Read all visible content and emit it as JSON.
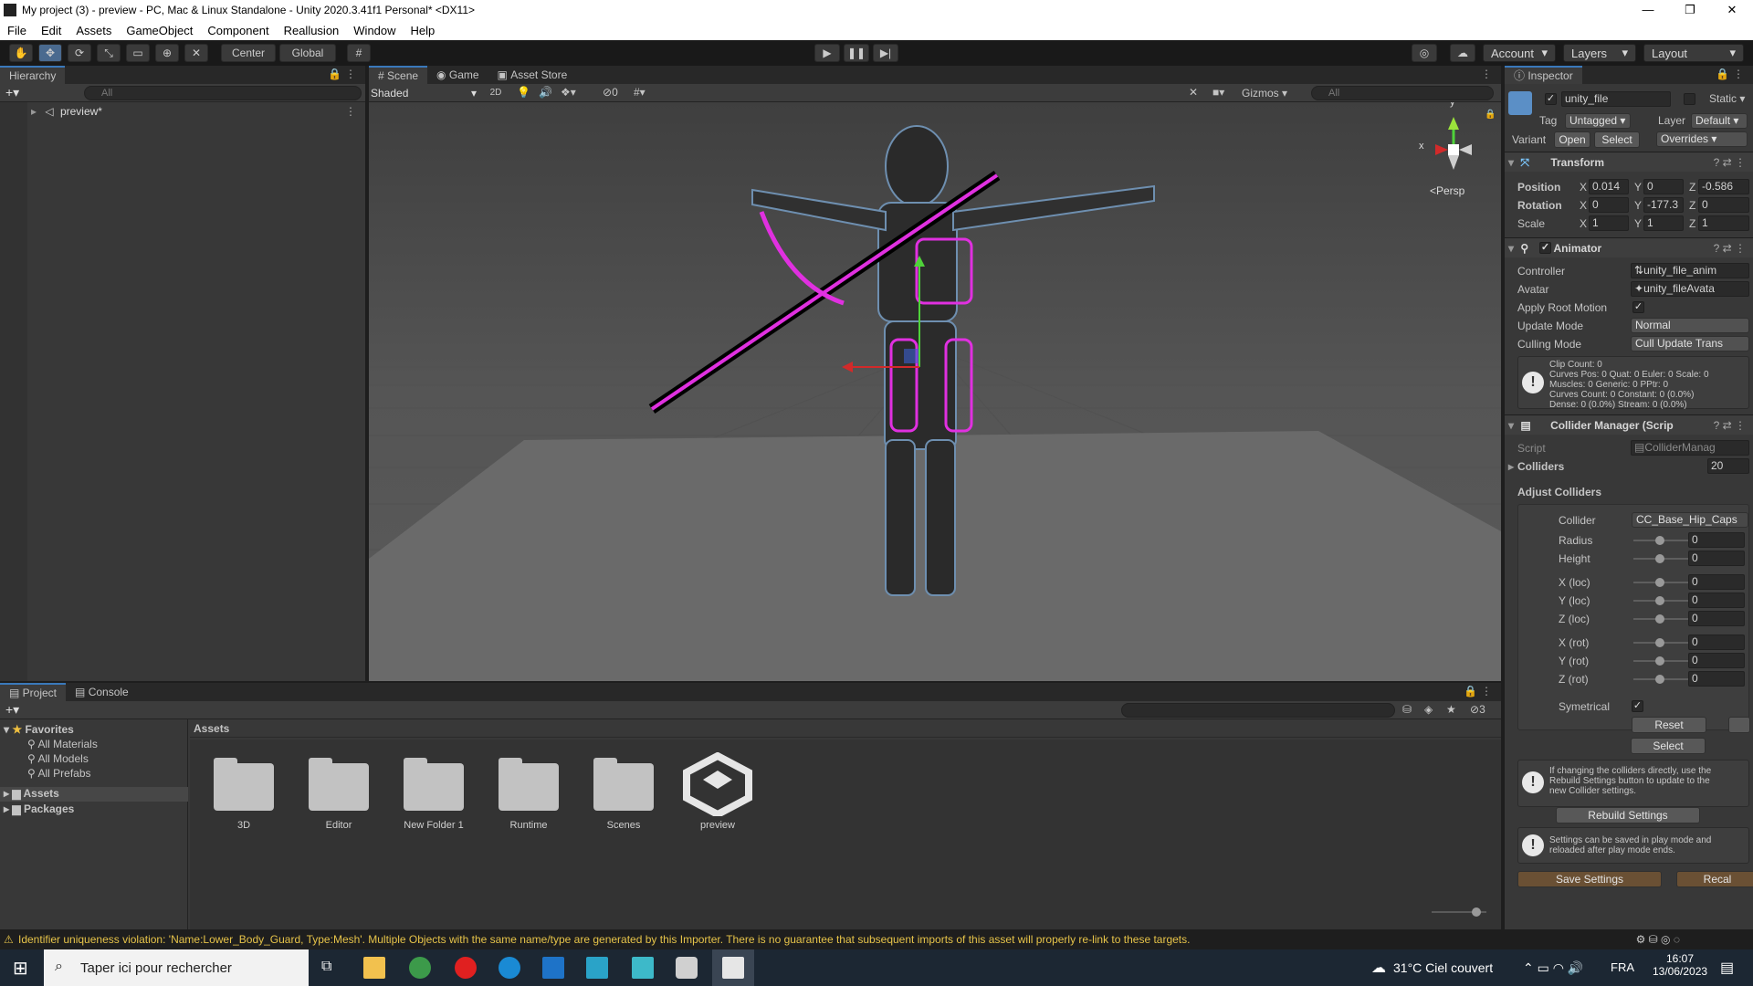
{
  "window": {
    "title": "My project (3) - preview - PC, Mac & Linux Standalone - Unity 2020.3.41f1 Personal* <DX11>"
  },
  "menu": [
    "File",
    "Edit",
    "Assets",
    "GameObject",
    "Component",
    "Reallusion",
    "Window",
    "Help"
  ],
  "toolbar": {
    "center_label": "Center",
    "global_label": "Global",
    "account_label": "Account",
    "layers_label": "Layers",
    "layout_label": "Layout"
  },
  "hierarchy": {
    "tab": "Hierarchy",
    "search_placeholder": "All",
    "root_item": "preview*"
  },
  "scene": {
    "tabs": [
      "Scene",
      "Game",
      "Asset Store"
    ],
    "shading_mode": "Shaded",
    "mode_2d": "2D",
    "hidden_count": "0",
    "gizmos_label": "Gizmos",
    "search_placeholder": "All",
    "persp_label": "<Persp",
    "axis_x": "x",
    "axis_y": "y"
  },
  "inspector": {
    "tab": "Inspector",
    "object_name": "unity_file",
    "static_label": "Static",
    "tag_label": "Tag",
    "tag_value": "Untagged",
    "layer_label": "Layer",
    "layer_value": "Default",
    "variant_label": "Variant",
    "open_label": "Open",
    "select_label": "Select",
    "overrides_label": "Overrides",
    "transform": {
      "title": "Transform",
      "position_label": "Position",
      "pos_x": "0.014",
      "pos_y": "0",
      "pos_z": "-0.586",
      "rotation_label": "Rotation",
      "rot_x": "0",
      "rot_y": "-177.3",
      "rot_z": "0",
      "scale_label": "Scale",
      "scale_x": "1",
      "scale_y": "1",
      "scale_z": "1",
      "x": "X",
      "y": "Y",
      "z": "Z"
    },
    "animator": {
      "title": "Animator",
      "controller_label": "Controller",
      "controller_value": "unity_file_anim",
      "avatar_label": "Avatar",
      "avatar_value": "unity_fileAvata",
      "apply_root_motion_label": "Apply Root Motion",
      "update_mode_label": "Update Mode",
      "update_mode_value": "Normal",
      "culling_mode_label": "Culling Mode",
      "culling_mode_value": "Cull Update Trans",
      "info_lines": [
        "Clip Count: 0",
        "Curves Pos: 0 Quat: 0 Euler: 0 Scale: 0",
        "Muscles: 0 Generic: 0 PPtr: 0",
        "Curves Count: 0 Constant: 0 (0.0%)",
        "Dense: 0 (0.0%) Stream: 0 (0.0%)"
      ]
    },
    "collider_manager": {
      "title": "Collider Manager (Scrip",
      "script_label": "Script",
      "script_value": "ColliderManag",
      "colliders_label": "Colliders",
      "colliders_value": "20",
      "adjust_label": "Adjust Colliders",
      "collider_label": "Collider",
      "collider_value": "CC_Base_Hip_Caps",
      "params": [
        {
          "label": "Radius",
          "value": "0"
        },
        {
          "label": "Height",
          "value": "0"
        },
        {
          "label": "X (loc)",
          "value": "0"
        },
        {
          "label": "Y (loc)",
          "value": "0"
        },
        {
          "label": "Z (loc)",
          "value": "0"
        },
        {
          "label": "X (rot)",
          "value": "0"
        },
        {
          "label": "Y (rot)",
          "value": "0"
        },
        {
          "label": "Z (rot)",
          "value": "0"
        }
      ],
      "symetrical_label": "Symetrical",
      "reset_label": "Reset",
      "select_label": "Select",
      "warning1": [
        "If changing the colliders directly, use the",
        "Rebuild Settings button to update to the",
        "new Collider settings."
      ],
      "rebuild_label": "Rebuild Settings",
      "warning2": [
        "Settings can be saved in play mode and",
        "reloaded after play mode ends."
      ],
      "save_label": "Save Settings",
      "recal_label": "Recal"
    }
  },
  "project": {
    "tabs": [
      "Project",
      "Console"
    ],
    "favorites_label": "Favorites",
    "favorites": [
      "All Materials",
      "All Models",
      "All Prefabs"
    ],
    "roots": [
      "Assets",
      "Packages"
    ],
    "breadcrumb": "Assets",
    "hidden_count": "3",
    "items": [
      {
        "name": "3D",
        "type": "folder"
      },
      {
        "name": "Editor",
        "type": "folder"
      },
      {
        "name": "New Folder 1",
        "type": "folder"
      },
      {
        "name": "Runtime",
        "type": "folder"
      },
      {
        "name": "Scenes",
        "type": "folder"
      },
      {
        "name": "preview",
        "type": "unity-scene"
      }
    ]
  },
  "status": {
    "message": "Identifier uniqueness violation: 'Name:Lower_Body_Guard, Type:Mesh'. Multiple Objects with the same name/type are generated by this Importer. There is no guarantee that subsequent imports of this asset will properly re-link to these targets."
  },
  "taskbar": {
    "search_placeholder": "Taper ici pour rechercher",
    "weather": "31°C  Ciel couvert",
    "language": "FRA",
    "time": "16:07",
    "date": "13/06/2023"
  }
}
